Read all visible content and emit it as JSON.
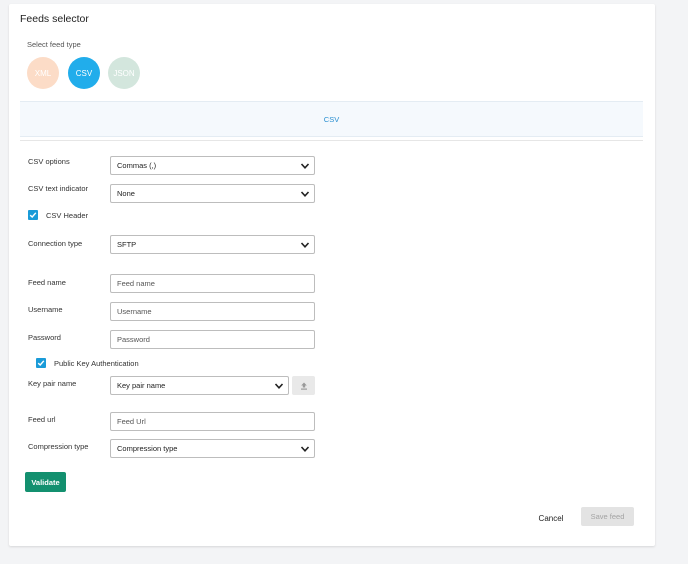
{
  "header": {
    "title": "Feeds selector",
    "select_feed_type_label": "Select feed type"
  },
  "feed_types": [
    {
      "label": "XML",
      "selected": false,
      "color": "#fcdcc7"
    },
    {
      "label": "CSV",
      "selected": true,
      "color": "#21adeb"
    },
    {
      "label": "JSON",
      "selected": false,
      "color": "#d3e6dd"
    }
  ],
  "banner": {
    "text": "CSV"
  },
  "form": {
    "csv_options": {
      "label": "CSV options",
      "value": "Commas (,)"
    },
    "csv_text_indicator": {
      "label": "CSV text indicator",
      "value": "None"
    },
    "csv_header": {
      "label": "CSV Header",
      "checked": true
    },
    "connection_type": {
      "label": "Connection type",
      "value": "SFTP"
    },
    "feed_name": {
      "label": "Feed name",
      "value": "",
      "placeholder": "Feed name"
    },
    "username": {
      "label": "Username",
      "value": "",
      "placeholder": "Username"
    },
    "password": {
      "label": "Password",
      "value": "",
      "placeholder": "Password"
    },
    "public_key_auth": {
      "label": "Public Key Authentication",
      "checked": true
    },
    "key_pair_name": {
      "label": "Key pair name",
      "value": "Key pair name"
    },
    "feed_url": {
      "label": "Feed url",
      "value": "",
      "placeholder": "Feed Url"
    },
    "compression_type": {
      "label": "Compression type",
      "value": "Compression type"
    }
  },
  "actions": {
    "validate_label": "Validate",
    "cancel_label": "Cancel",
    "save_label": "Save feed"
  },
  "colors": {
    "accent": "#21adeb",
    "validate": "#13906f",
    "checkbox": "#1a9bd8",
    "save_disabled_bg": "#e3e3e3"
  }
}
